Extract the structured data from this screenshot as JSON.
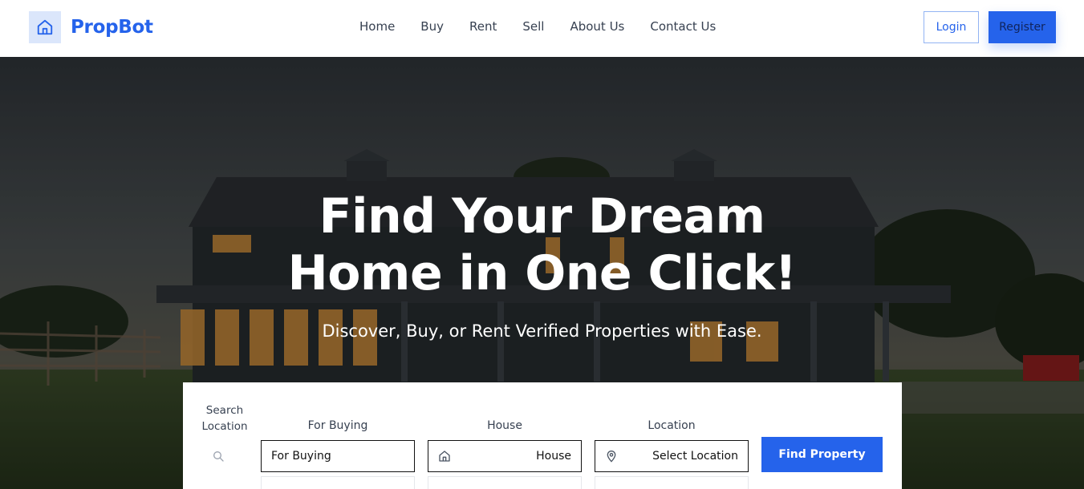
{
  "brand": {
    "name": "PropBot",
    "icon": "house-icon",
    "color": "#2563eb"
  },
  "nav": {
    "items": [
      "Home",
      "Buy",
      "Rent",
      "Sell",
      "About Us",
      "Contact Us"
    ]
  },
  "auth": {
    "login_label": "Login",
    "register_label": "Register"
  },
  "hero": {
    "title_line1": "Find Your Dream",
    "title_line2": "Home in One Click!",
    "subtitle": "Discover, Buy, or Rent Verified Properties with Ease."
  },
  "search": {
    "label_line1": "Search",
    "label_line2": "Location",
    "purpose": {
      "label": "For Buying",
      "value": "For Buying"
    },
    "type": {
      "label": "House",
      "value": "House",
      "icon": "house-icon"
    },
    "location": {
      "label": "Location",
      "value": "Select Location",
      "icon": "map-pin-icon"
    },
    "submit_label": "Find Property"
  },
  "colors": {
    "accent": "#2563eb",
    "navbar_bg": "#ffffff",
    "card_bg": "#ffffff"
  }
}
